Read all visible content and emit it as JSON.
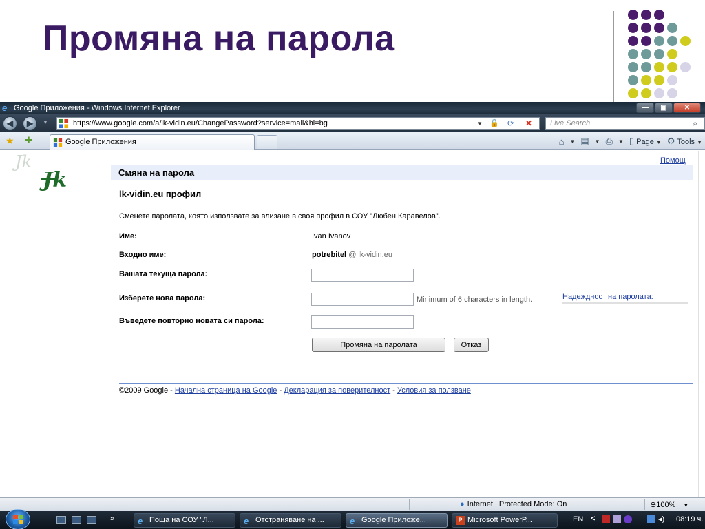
{
  "slide": {
    "title": "Промяна на парола",
    "accent_color": "#3a1a63",
    "dot_colors": {
      "purple": "#4b1c6b",
      "teal": "#6f9a9a",
      "yellow": "#cfcc1e",
      "lavender": "#d6d4e6"
    }
  },
  "browser": {
    "window_title": "Google Приложения - Windows Internet Explorer",
    "window_controls": {
      "minimize": "—",
      "maximize": "▣",
      "close": "✕"
    },
    "address_url": "https://www.google.com/a/lk-vidin.eu/ChangePassword?service=mail&hl=bg",
    "search_placeholder": "Live Search",
    "tab_label": "Google Приложения",
    "command_bar": {
      "page": "Page",
      "tools": "Tools"
    },
    "icons": [
      "back-icon",
      "forward-icon",
      "favorites-star-icon",
      "add-favorites-icon",
      "home-icon",
      "feeds-icon",
      "print-icon",
      "page-icon",
      "tools-gear-icon",
      "lock-icon",
      "refresh-icon",
      "stop-icon",
      "search-icon"
    ]
  },
  "page": {
    "help_link": "Помощ",
    "header": "Смяна на парола",
    "profile_title": "lk-vidin.eu профил",
    "intro": "Сменете паролата, която използвате за влизане в своя профил в СОУ \"Любен Каравелов\".",
    "fields": {
      "name_label": "Име:",
      "name_value": "Ivan Ivanov",
      "username_label": "Входно име:",
      "username_value": "potrebitel",
      "username_domain": "@ lk-vidin.eu",
      "current_password_label": "Вашата текуща парола:",
      "new_password_label": "Изберете нова парола:",
      "confirm_password_label": "Въведете повторно новата си парола:",
      "current_password_value": "",
      "new_password_value": "",
      "confirm_password_value": ""
    },
    "min_length_note": "Minimum of 6 characters in length.",
    "strength_link": "Надеждност на паролата:",
    "buttons": {
      "save": "Промяна на паролата",
      "cancel": "Отказ"
    },
    "footer": {
      "copyright": "©2009 Google - ",
      "home_link": "Начална страница на Google",
      "sep1": " - ",
      "privacy_link": "Декларация за поверителност",
      "sep2": " - ",
      "terms_link": "Условия за ползване"
    }
  },
  "statusbar": {
    "zone": "Internet | Protected Mode: On",
    "zoom": "100%"
  },
  "taskbar": {
    "buttons": [
      "Поща на СОУ \"Л...",
      "Отстраняване на ...",
      "Google Приложе...",
      "Microsoft PowerP..."
    ],
    "active_index": 2,
    "language": "EN",
    "clock": "08:19 ч."
  }
}
